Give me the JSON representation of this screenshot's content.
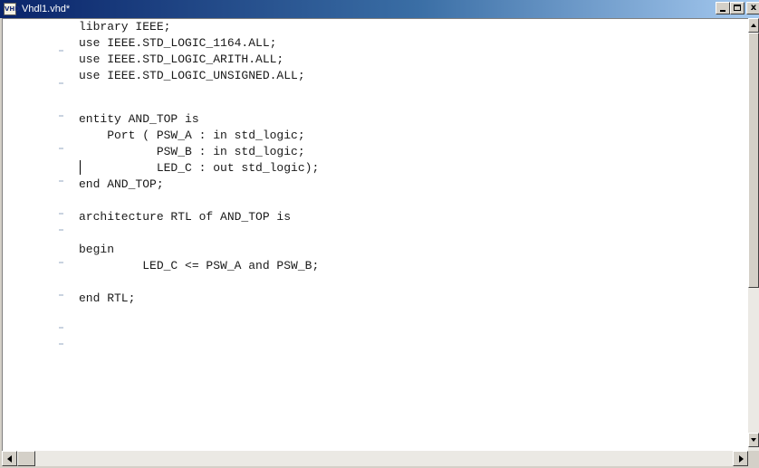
{
  "window": {
    "title": "Vhdl1.vhd*",
    "icon": "vhdl-file-icon",
    "icon_text": "VHD",
    "close_label": "x"
  },
  "editor": {
    "lines": [
      "library IEEE;",
      "use IEEE.STD_LOGIC_1164.ALL;",
      "use IEEE.STD_LOGIC_ARITH.ALL;",
      "use IEEE.STD_LOGIC_UNSIGNED.ALL;",
      "",
      "entity AND_TOP is",
      "    Port ( PSW_A : in std_logic;",
      "           PSW_B : in std_logic;",
      "           LED_C : out std_logic);",
      "end AND_TOP;",
      "",
      "architecture RTL of AND_TOP is",
      "",
      "begin",
      "         LED_C <= PSW_A and PSW_B;",
      "",
      "end RTL;"
    ]
  },
  "colors": {
    "titlebar_start": "#0a246a",
    "titlebar_end": "#a6caf0",
    "editor_background": "#ffffff",
    "code_text": "#1a1a1a",
    "chrome": "#d4d0c8"
  }
}
